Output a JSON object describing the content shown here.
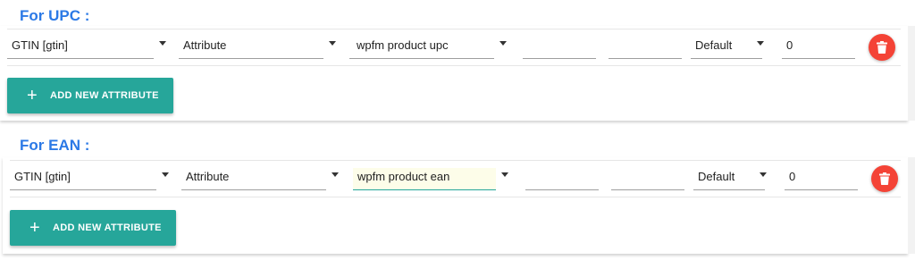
{
  "upc": {
    "heading": "For UPC :",
    "fields": {
      "product_id": "GTIN [gtin]",
      "type": "Attribute",
      "value": "wpfm product upc",
      "extra1": "",
      "extra2": "",
      "mode": "Default",
      "number": "0"
    },
    "add_button_label": "ADD NEW ATTRIBUTE"
  },
  "ean": {
    "heading": "For EAN :",
    "fields": {
      "product_id": "GTIN [gtin]",
      "type": "Attribute",
      "value": "wpfm product ean",
      "extra1": "",
      "extra2": "",
      "mode": "Default",
      "number": "0"
    },
    "add_button_label": "ADD NEW ATTRIBUTE"
  },
  "icons": {
    "delete": "trash-icon",
    "add": "plus-icon",
    "dropdown": "chevron-down-icon"
  },
  "colors": {
    "heading": "#2b79e6",
    "primary_button": "#26a69a",
    "delete_button": "#f44336",
    "active_underline": "#26a69a"
  }
}
